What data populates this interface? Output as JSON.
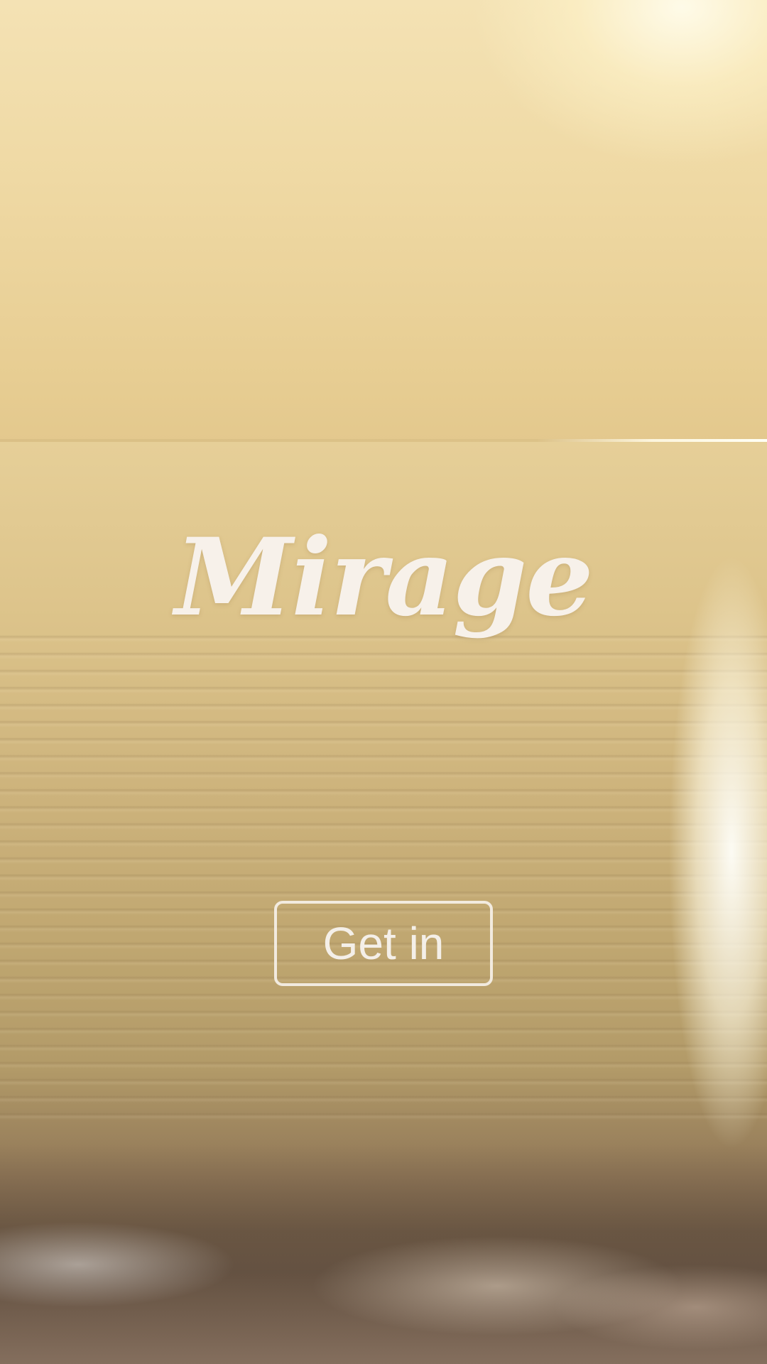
{
  "app": {
    "logo_text": "Mirage"
  },
  "actions": {
    "get_in_label": "Get in"
  },
  "colors": {
    "logo": "#f7f1ea",
    "button_border": "#f7f2eb",
    "button_text": "#f4efe8",
    "sky": "#efd9a4",
    "sea": "#cdb37c"
  }
}
